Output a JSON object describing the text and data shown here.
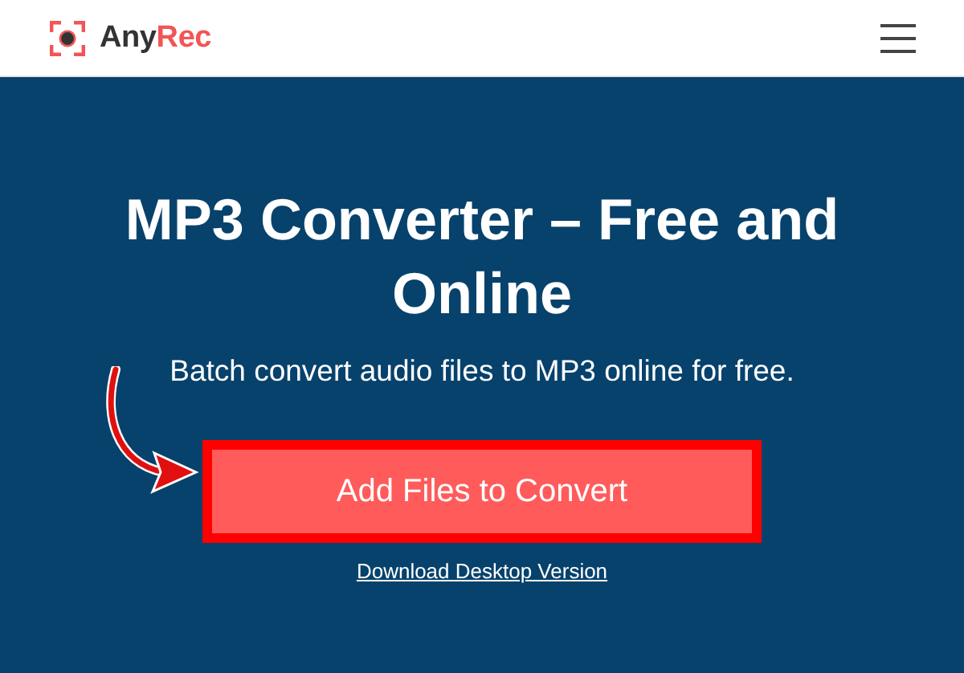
{
  "header": {
    "logo": [
      {
        "text": "Any",
        "color": "#333333"
      },
      {
        "text": "Rec",
        "color": "#f25555"
      }
    ]
  },
  "hero": {
    "title": "MP3 Converter – Free and Online",
    "subtitle": "Batch convert audio files to MP3 online for free.",
    "button": {
      "label": "Add Files to Convert",
      "highlighted": true
    },
    "link": "Download Desktop Version"
  }
}
